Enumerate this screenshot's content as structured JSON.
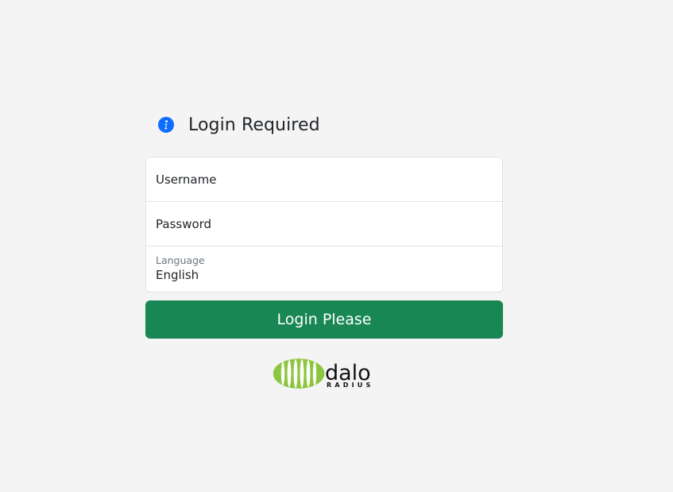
{
  "heading": {
    "icon": "info-icon",
    "title": "Login Required"
  },
  "form": {
    "username_placeholder": "Username",
    "password_placeholder": "Password",
    "language_label": "Language",
    "language_value": "English",
    "submit_label": "Login Please"
  },
  "logo": {
    "word": "dalo",
    "subword": "RADIUS",
    "icon": "globe-logo-icon"
  },
  "colors": {
    "page_bg": "#f4f4f4",
    "accent_blue": "#0d6efd",
    "button_green": "#198754",
    "logo_green": "#8cc63f"
  }
}
